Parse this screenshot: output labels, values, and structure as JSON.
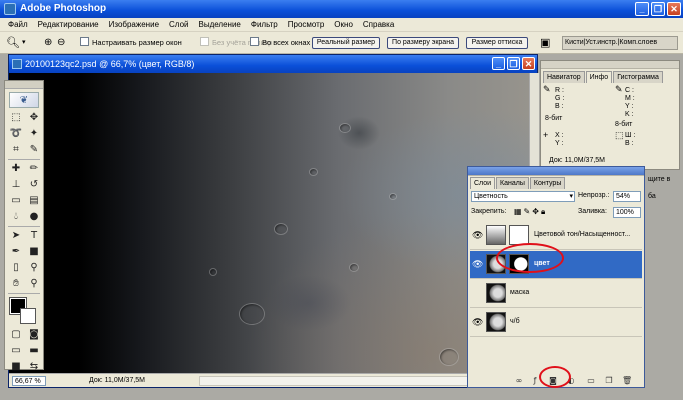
{
  "app": {
    "title": "Adobe Photoshop"
  },
  "menu": [
    "Файл",
    "Редактирование",
    "Изображение",
    "Слой",
    "Выделение",
    "Фильтр",
    "Просмотр",
    "Окно",
    "Справка"
  ],
  "options": {
    "resize_windows": "Настраивать размер окон",
    "ignore_palettes": "Без учёта палитр",
    "all_windows": "Во всех окнах",
    "actual_pixels": "Реальный размер",
    "fit_screen": "По размеру экрана",
    "print_size": "Размер оттиска",
    "palette_well": "Кисти|Уст.инстр.|Комп.слоев"
  },
  "document": {
    "title": "20100123qc2.psd @ 66,7% (цвет, RGB/8)",
    "zoom": "66,67 %",
    "doc_info": "Док: 11,0M/37,5M"
  },
  "info_panel": {
    "tabs": [
      "Навигатор",
      "Инфо",
      "Гистограмма"
    ],
    "active_tab": "Инфо",
    "rgb": [
      "R :",
      "G :",
      "B :"
    ],
    "cmyk": [
      "C :",
      "M :",
      "Y :",
      "K :"
    ],
    "bits_left": "8-бит",
    "bits_right": "8-бит",
    "xy": [
      "X :",
      "Y :"
    ],
    "wh": [
      "Ш :",
      "В :"
    ],
    "doc_info": "Док: 11,0M/37,5M",
    "partial1": "щите в",
    "partial2": "ба"
  },
  "layers_panel": {
    "tabs": [
      "Слои",
      "Каналы",
      "Контуры"
    ],
    "active_tab": "Слои",
    "blend_mode": "Цветность",
    "opacity_label": "Непрозр.:",
    "opacity": "54%",
    "lock_label": "Закрепить:",
    "fill_label": "Заливка:",
    "fill": "100%",
    "layers": [
      {
        "name": "Цветовой тон/Насыщенност...",
        "visible": true,
        "selected": false
      },
      {
        "name": "цвет",
        "visible": true,
        "selected": true
      },
      {
        "name": "маска",
        "visible": false,
        "selected": false
      },
      {
        "name": "ч/б",
        "visible": true,
        "selected": false
      }
    ]
  },
  "accent": {
    "titlebar": "#0a4fd8",
    "selection": "#316ac5",
    "highlight_ellipse": "#e0101a"
  }
}
